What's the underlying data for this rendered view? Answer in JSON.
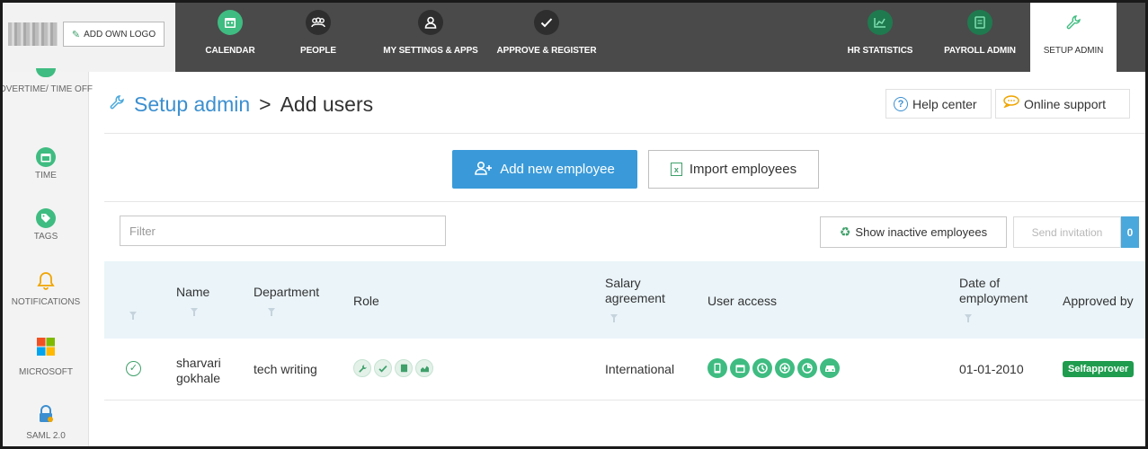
{
  "topbar": {
    "own_logo_label": "ADD OWN LOGO",
    "nav": [
      {
        "label": "CALENDAR",
        "icon": "calendar-icon"
      },
      {
        "label": "PEOPLE",
        "icon": "people-icon"
      },
      {
        "label": "MY SETTINGS & APPS",
        "icon": "person-icon"
      },
      {
        "label": "APPROVE & REGISTER",
        "icon": "check-icon"
      },
      {
        "label": "HR STATISTICS",
        "icon": "chart-icon"
      },
      {
        "label": "PAYROLL ADMIN",
        "icon": "book-icon"
      },
      {
        "label": "SETUP ADMIN",
        "icon": "wrench-icon"
      }
    ]
  },
  "sidebar": {
    "items": [
      {
        "label": "OVERTIME/ TIME OFF",
        "icon": "overtime-icon"
      },
      {
        "label": "TIME",
        "icon": "clock-calendar-icon"
      },
      {
        "label": "TAGS",
        "icon": "tag-icon"
      },
      {
        "label": "NOTIFICATIONS",
        "icon": "bell-icon"
      },
      {
        "label": "MICROSOFT",
        "icon": "microsoft-icon"
      },
      {
        "label": "SAML 2.0",
        "icon": "lock-icon"
      }
    ]
  },
  "header": {
    "breadcrumb_root": "Setup admin",
    "separator": ">",
    "current": "Add users",
    "help_label": "Help center",
    "support_label": "Online support"
  },
  "actions": {
    "add_employee_label": "Add new employee",
    "import_label": "Import employees"
  },
  "filter": {
    "placeholder": "Filter",
    "show_inactive_label": "Show inactive employees",
    "send_invitation_label": "Send invitation",
    "invitation_count": "0"
  },
  "table": {
    "columns": {
      "name": "Name",
      "department": "Department",
      "role": "Role",
      "salary_agreement": "Salary agreement",
      "user_access": "User access",
      "date_of_employment": "Date of employment",
      "approved_by": "Approved by"
    },
    "rows": [
      {
        "name": "sharvari gokhale",
        "department": "tech writing",
        "role_icons": [
          "wrench-icon",
          "check-icon",
          "book-icon",
          "chart-icon"
        ],
        "salary_agreement": "International",
        "access_icons": [
          "phone-icon",
          "calendar-icon",
          "clock-icon",
          "plus-icon",
          "pie-icon",
          "car-icon"
        ],
        "date_of_employment": "01-01-2010",
        "approved_by": "Selfapprover"
      }
    ]
  },
  "colors": {
    "accent_blue": "#3a9ad9",
    "green": "#3fbc81",
    "topbar": "#4a4a4a",
    "header_row": "#eaf4f9"
  }
}
